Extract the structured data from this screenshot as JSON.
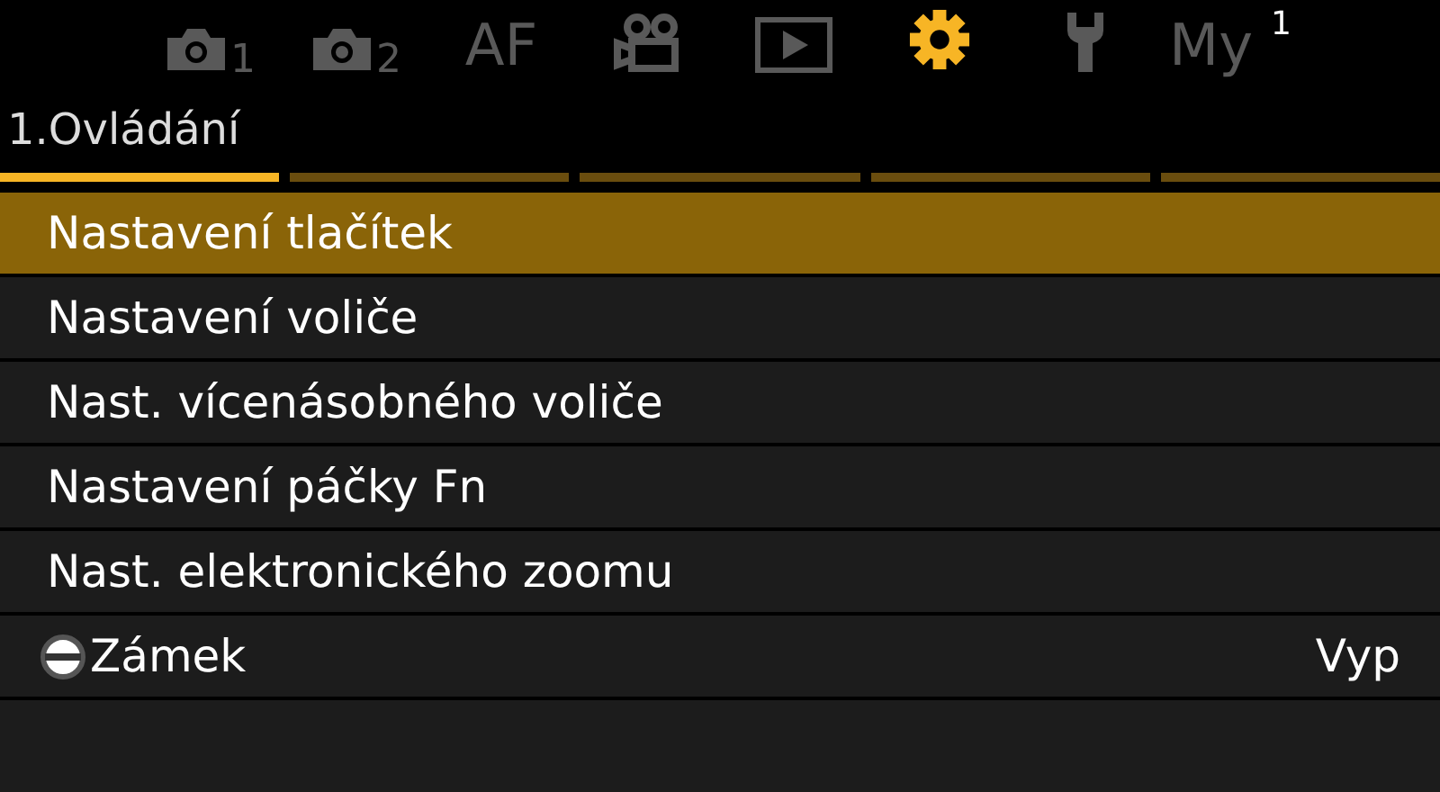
{
  "tabs": [
    {
      "kind": "camera",
      "sub": "1",
      "selected": false
    },
    {
      "kind": "camera",
      "sub": "2",
      "selected": false
    },
    {
      "kind": "text",
      "label": "AF",
      "selected": false
    },
    {
      "kind": "movie",
      "selected": false
    },
    {
      "kind": "playback",
      "selected": false
    },
    {
      "kind": "gear",
      "selected": true
    },
    {
      "kind": "wrench",
      "selected": false
    },
    {
      "kind": "text",
      "label": "My",
      "badge": "1",
      "selected": false
    }
  ],
  "page_title": "1.Ovládání",
  "pages": [
    {
      "selected": true
    },
    {
      "selected": false
    },
    {
      "selected": false
    },
    {
      "selected": false
    },
    {
      "selected": false
    }
  ],
  "items": [
    {
      "kind": "submenu",
      "label": "Nastavení tlačítek",
      "selected": true
    },
    {
      "kind": "submenu",
      "label": "Nastavení voliče",
      "selected": false
    },
    {
      "kind": "submenu",
      "label": "Nast. vícenásobného voliče",
      "selected": false
    },
    {
      "kind": "submenu",
      "label": "Nastavení páčky Fn",
      "selected": false
    },
    {
      "kind": "submenu",
      "label": "Nast. elektronického zoomu",
      "selected": false
    },
    {
      "kind": "lock",
      "label": "Zámek",
      "selected": false,
      "value": "Vyp"
    }
  ]
}
